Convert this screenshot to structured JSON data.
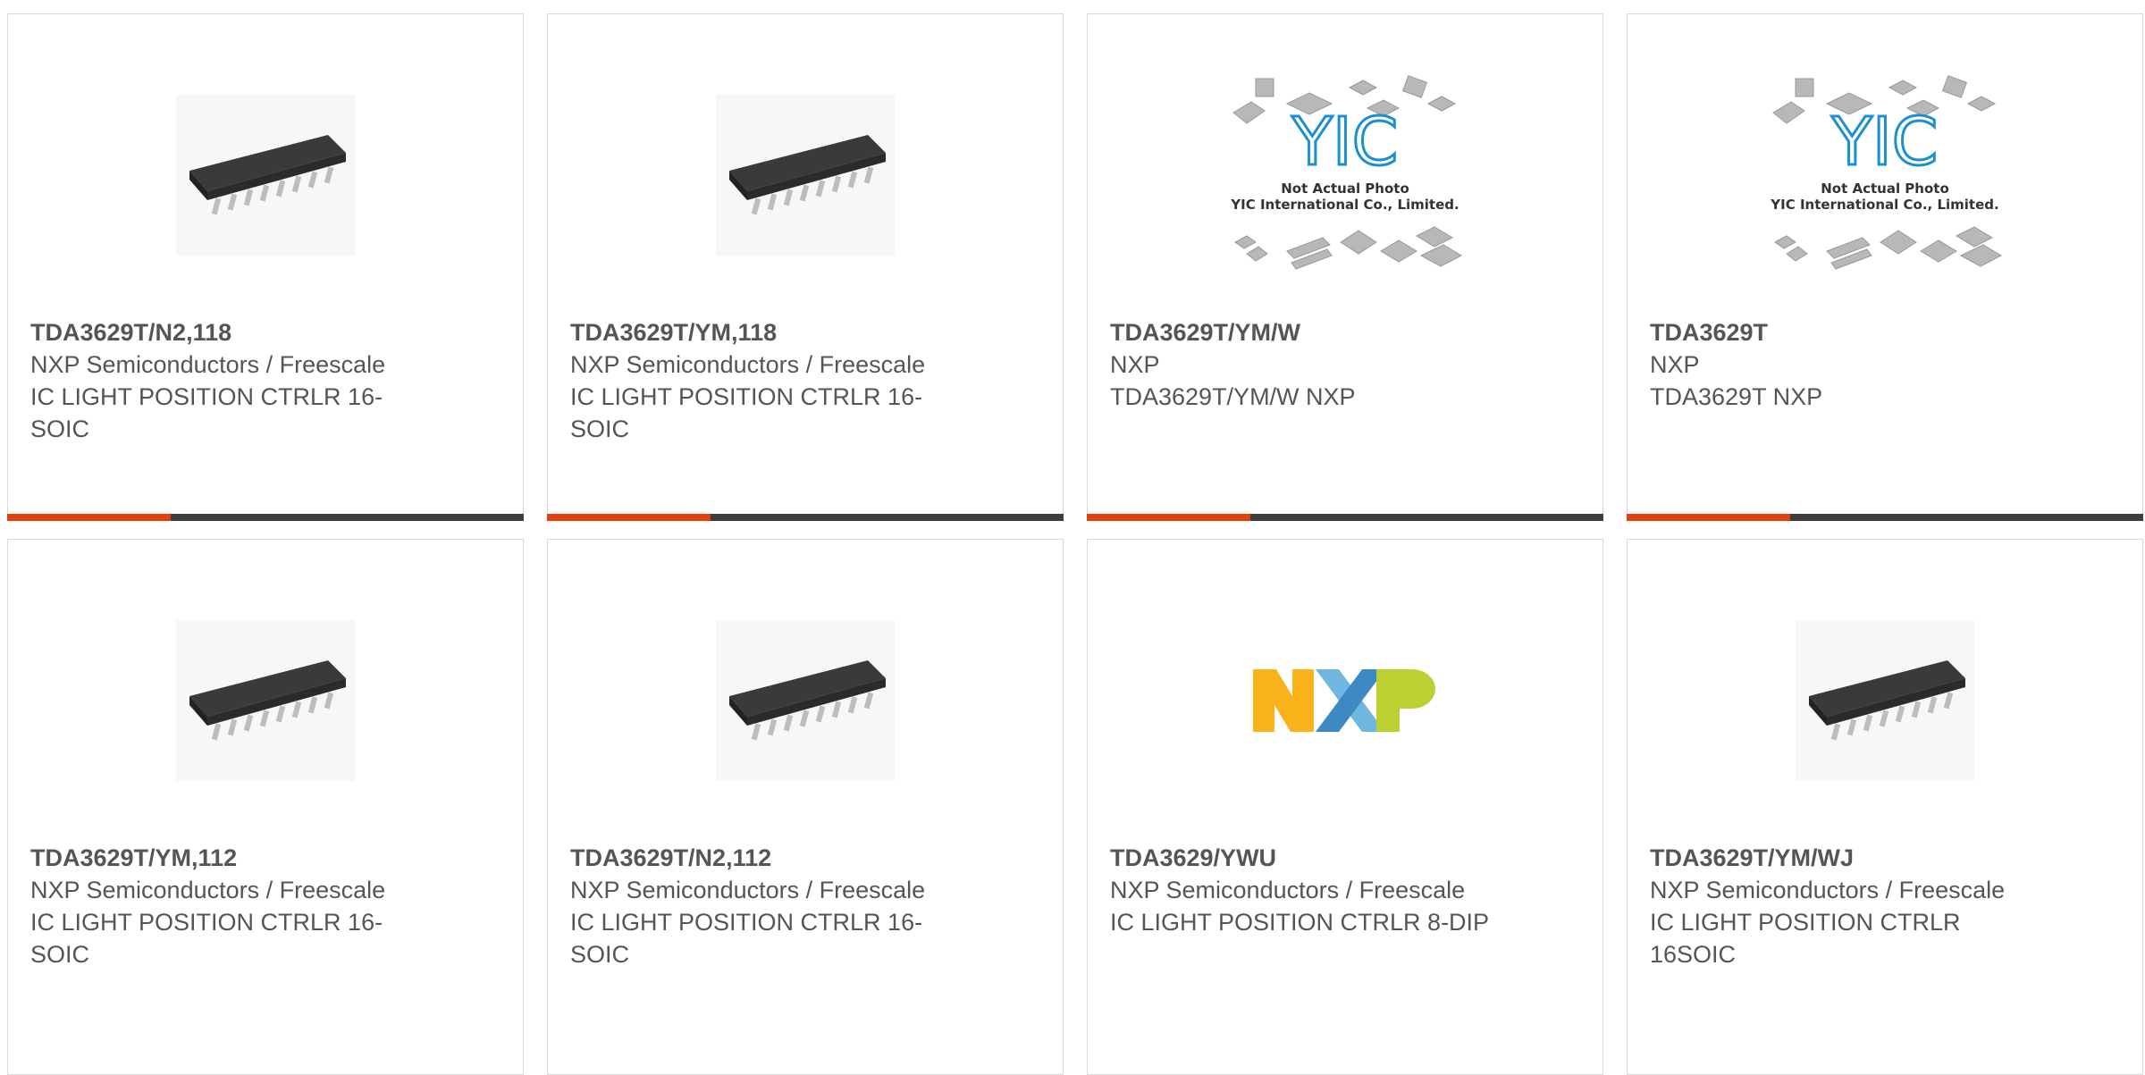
{
  "products": [
    {
      "part": "TDA3629T/N2,118",
      "manufacturer": "NXP Semiconductors / Freescale",
      "description": "IC LIGHT POSITION CTRLR 16-SOIC",
      "image": "soic-chip"
    },
    {
      "part": "TDA3629T/YM,118",
      "manufacturer": "NXP Semiconductors / Freescale",
      "description": "IC LIGHT POSITION CTRLR 16-SOIC",
      "image": "soic-chip"
    },
    {
      "part": "TDA3629T/YM/W",
      "manufacturer": "NXP",
      "description": "TDA3629T/YM/W NXP",
      "image": "yic-placeholder"
    },
    {
      "part": "TDA3629T",
      "manufacturer": "NXP",
      "description": "TDA3629T NXP",
      "image": "yic-placeholder"
    },
    {
      "part": "TDA3629T/YM,112",
      "manufacturer": "NXP Semiconductors / Freescale",
      "description": "IC LIGHT POSITION CTRLR 16-SOIC",
      "image": "soic-chip"
    },
    {
      "part": "TDA3629T/N2,112",
      "manufacturer": "NXP Semiconductors / Freescale",
      "description": "IC LIGHT POSITION CTRLR 16-SOIC",
      "image": "soic-chip"
    },
    {
      "part": "TDA3629/YWU",
      "manufacturer": "NXP Semiconductors / Freescale",
      "description": "IC LIGHT POSITION CTRLR 8-DIP",
      "image": "nxp-logo"
    },
    {
      "part": "TDA3629T/YM/WJ",
      "manufacturer": "NXP Semiconductors / Freescale",
      "description": "IC LIGHT POSITION CTRLR 16SOIC",
      "image": "soic-chip"
    }
  ],
  "placeholder_image": {
    "logo_text": "YIC",
    "caption_line1": "Not Actual Photo",
    "caption_line2": "YIC International Co., Limited."
  },
  "brand_logo": "NXP",
  "colors": {
    "accent": "#e2400f",
    "bar": "#3d3d3d",
    "border": "#d9d9d9",
    "text": "#555555",
    "yic_blue": "#1b8fcf",
    "nxp_orange": "#f9b21a",
    "nxp_blue": "#6fb7e0",
    "nxp_green": "#bcd031"
  }
}
